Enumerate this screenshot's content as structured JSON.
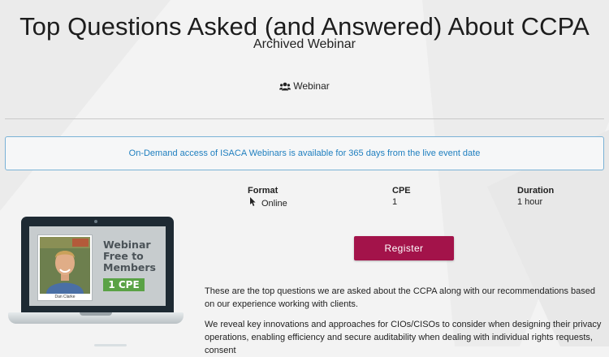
{
  "header": {
    "title": "Top Questions Asked (and Answered) About CCPA",
    "subtitle": "Archived Webinar",
    "type_icon": "users-icon",
    "type_label": "Webinar"
  },
  "notice": {
    "text": "On-Demand access of ISACA Webinars is available for 365 days from the live event date"
  },
  "details": {
    "format_label": "Format",
    "format_icon": "mouse-pointer-icon",
    "format_value": "Online",
    "cpe_label": "CPE",
    "cpe_value": "1",
    "duration_label": "Duration",
    "duration_value": "1 hour"
  },
  "actions": {
    "register_label": "Register"
  },
  "promo": {
    "title": "Webinar Free to Members",
    "badge": "1 CPE",
    "presenter_caption": "Dan Clarke"
  },
  "description": {
    "p1": "These are the top questions we are asked about the CCPA along with our recommendations based on our experience working with clients.",
    "p2": "We reveal key innovations and approaches for CIOs/CISOs to consider when designing their privacy operations, enabling efficiency and secure auditability when dealing with individual rights requests, consent"
  },
  "colors": {
    "register_button": "#a3134a",
    "notice_text": "#1f7fbf",
    "notice_border": "#7ab2d6",
    "badge_green": "#5aa246"
  }
}
